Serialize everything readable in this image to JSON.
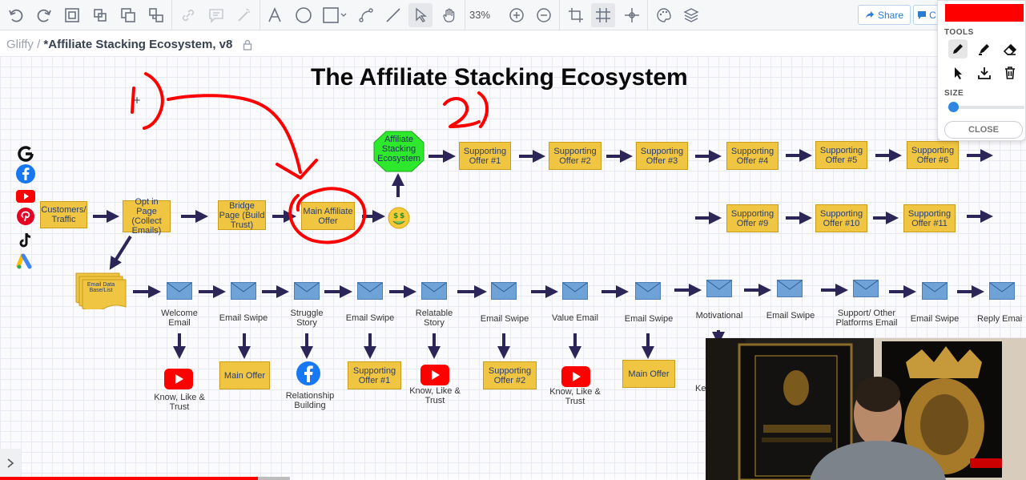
{
  "toolbar": {
    "zoom": "33%",
    "share_label": "Share",
    "comment_label": "C"
  },
  "breadcrumb": {
    "app": "Gliffy",
    "separator": "/",
    "document": "*Affiliate Stacking Ecosystem, v8"
  },
  "tools_panel": {
    "color": "#ff0000",
    "tools_heading": "TOOLS",
    "size_heading": "SIZE",
    "size_value": 0.05,
    "close_label": "CLOSE"
  },
  "diagram": {
    "title": "The Affiliate Stacking Ecosystem",
    "annotations": {
      "one": "1)",
      "two": "2)"
    },
    "main_row": {
      "customers": "Customers/ Traffic",
      "optin": "Opt in Page (Collect Emails)",
      "bridge": "Bridge Page (Build Trust)",
      "main_offer": "Main Affiliate Offer",
      "ecosystem": "Affiliate Stacking Ecosystem"
    },
    "supporting_top": [
      "Supporting Offer #1",
      "Supporting Offer #2",
      "Supporting Offer #3",
      "Supporting Offer #4",
      "Supporting Offer #5",
      "Supporting Offer #6"
    ],
    "supporting_mid": [
      "Supporting Offer #9",
      "Supporting Offer #10",
      "Supporting Offer #11"
    ],
    "email_db": "Email Data Base/List",
    "emails": [
      "Welcome Email",
      "Email Swipe",
      "Struggle Story",
      "Email Swipe",
      "Relatable Story",
      "Email Swipe",
      "Value Email",
      "Email Swipe",
      "Motivational",
      "Email Swipe",
      "Support/ Other Platforms Email",
      "Email Swipe",
      "Reply Emai"
    ],
    "outcomes": {
      "o1": "Know, Like & Trust",
      "o2": "Main Offer",
      "o3": "Relationship Building",
      "o4": "Supporting Offer #1",
      "o5": "Know, Like & Trust",
      "o6": "Supporting Offer #2",
      "o7": "Know, Like & Trust",
      "o8": "Main Offer",
      "o9": "Ke"
    }
  },
  "colors": {
    "box_fill": "#f0c541",
    "arrow": "#2b2558",
    "ecosystem": "#2ee82e",
    "annotation": "#ff0000"
  },
  "video": {
    "progress": 0.25
  }
}
